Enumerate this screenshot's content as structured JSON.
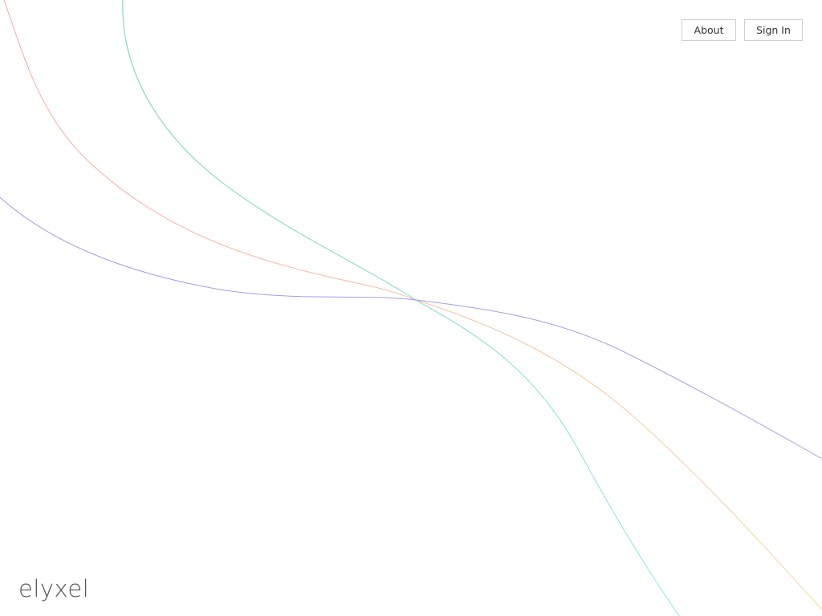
{
  "header": {
    "about_label": "About",
    "signin_label": "Sign In"
  },
  "brand": {
    "logo_text": "elyxel"
  },
  "decoration": {
    "curves": [
      {
        "name": "coral-curve",
        "color_start": "#f8a5a5",
        "color_end": "#f7d8a0"
      },
      {
        "name": "mint-curve",
        "color_start": "#6fd3a8",
        "color_end": "#8fe6e8"
      },
      {
        "name": "violet-curve",
        "color_start": "#9b9be8",
        "color_end": "#a9a4e8"
      }
    ]
  }
}
